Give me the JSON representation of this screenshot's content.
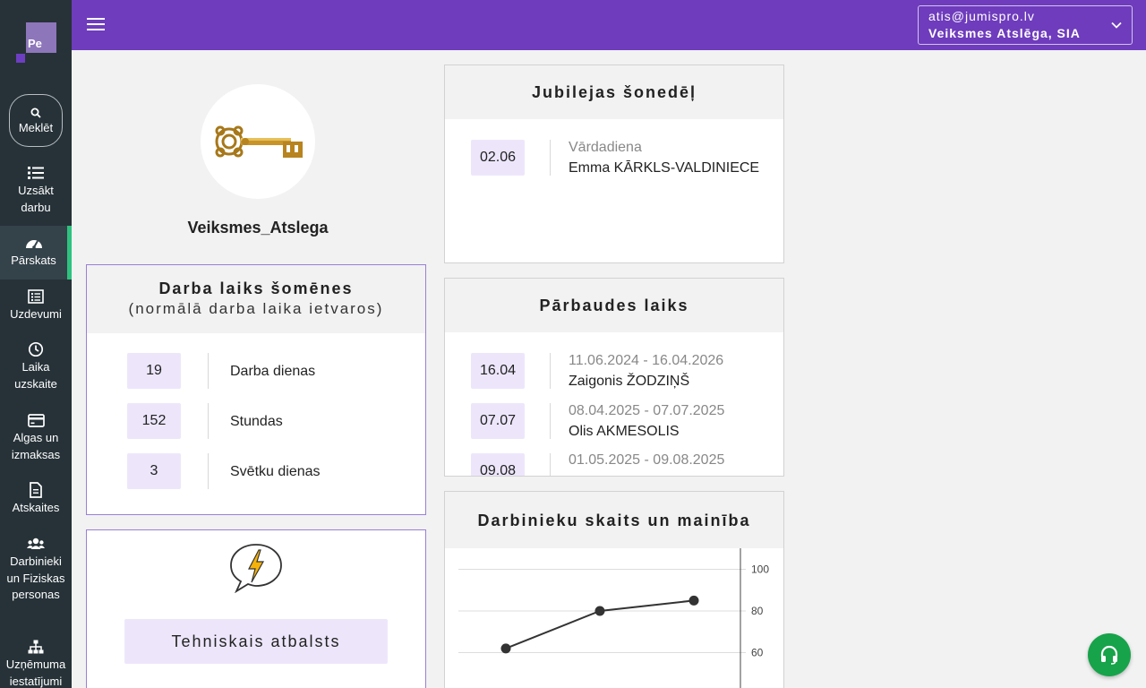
{
  "logo": {
    "text": "Pe"
  },
  "sidebar": {
    "search_label": "Meklēt",
    "items": [
      {
        "label": "Uzsākt darbu",
        "icon": "list-icon"
      },
      {
        "label": "Pārskats",
        "icon": "dashboard-icon",
        "active": true
      },
      {
        "label": "Uzdevumi",
        "icon": "tasks-icon"
      },
      {
        "label": "Laika uzskaite",
        "icon": "clock-icon"
      },
      {
        "label": "Algas un izmaksas",
        "icon": "credit-card-icon"
      },
      {
        "label": "Atskaites",
        "icon": "document-icon"
      },
      {
        "label": "Darbinieki un Fiziskas personas",
        "icon": "users-icon"
      },
      {
        "label": "Uzņēmuma iestatījumi",
        "icon": "sitemap-icon"
      }
    ]
  },
  "account": {
    "email": "atis@jumispro.lv",
    "company": "Veiksmes Atslēga, SIA"
  },
  "profile": {
    "name": "Veiksmes_Atslega"
  },
  "work_time": {
    "title": "Darba laiks šomēnes",
    "subtitle": "(normālā darba laika ietvaros)",
    "rows": [
      {
        "value": "19",
        "label": "Darba dienas"
      },
      {
        "value": "152",
        "label": "Stundas"
      },
      {
        "value": "3",
        "label": "Svētku dienas"
      }
    ]
  },
  "support": {
    "button_label": "Tehniskais atbalsts"
  },
  "jubilees": {
    "title": "Jubilejas šonedēļ",
    "rows": [
      {
        "date": "02.06",
        "type": "Vārdadiena",
        "name": "Emma KĀRKLS-VALDINIECE"
      }
    ]
  },
  "probation": {
    "title": "Pārbaudes laiks",
    "rows": [
      {
        "date": "16.04",
        "period": "11.06.2024 - 16.04.2026",
        "name": "Zaigonis ŽODZIŅŠ"
      },
      {
        "date": "07.07",
        "period": "08.04.2025 - 07.07.2025",
        "name": "Olis AKMESOLIS"
      },
      {
        "date": "09.08",
        "period": "01.05.2025 - 09.08.2025",
        "name": ""
      }
    ]
  },
  "headcount": {
    "title": "Darbinieku skaits un mainība",
    "chart_data": {
      "type": "line",
      "y_ticks": [
        "100",
        "80",
        "60"
      ],
      "ylim": [
        40,
        105
      ],
      "y_axis_side": "right",
      "grid": true,
      "series": [
        {
          "values": [
            62,
            80,
            85
          ]
        }
      ],
      "color": "#333333"
    }
  },
  "colors": {
    "topbar": "#6e3cbc",
    "sidebar": "#263238",
    "badge": "#ede6fb",
    "active_marker": "#2ec27e",
    "fab": "#17a34a"
  }
}
